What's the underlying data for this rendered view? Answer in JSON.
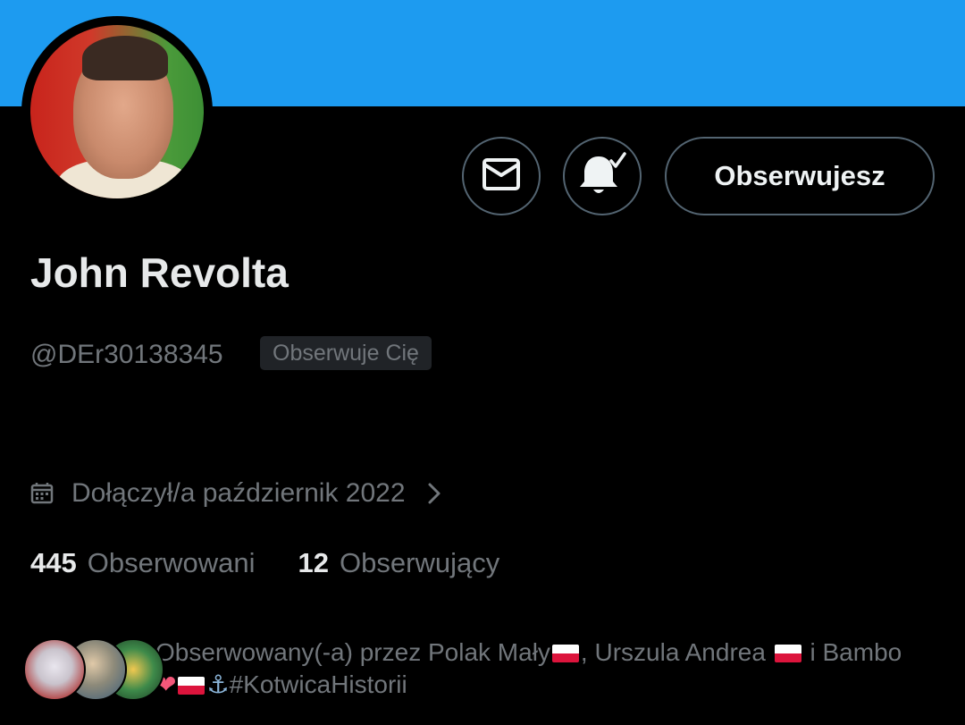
{
  "profile": {
    "name": "John Revolta",
    "handle": "@DEr30138345",
    "follows_you_badge": "Obserwuje Cię",
    "joined": "Dołączył/a październik 2022",
    "following_count": "445",
    "following_label": "Obserwowani",
    "followers_count": "12",
    "followers_label": "Obserwujący"
  },
  "actions": {
    "message_icon": "mail-icon",
    "notifications_icon": "bell-check-icon",
    "follow_button_label": "Obserwujesz"
  },
  "followed_by": {
    "prefix": "Obserwowany(-a) przez",
    "name1": "Polak Mały",
    "separator": ",",
    "name2": "Urszula Andrea",
    "conjunction": "i",
    "name3_prefix": "Bambo",
    "name3_heart": "❤",
    "name3_anchor": "⚓",
    "name3_suffix": "#KotwicaHistorii"
  },
  "colors": {
    "banner": "#1d9bf0",
    "muted_text": "#71767b",
    "primary_text": "#e7e9ea",
    "background": "#000000"
  }
}
